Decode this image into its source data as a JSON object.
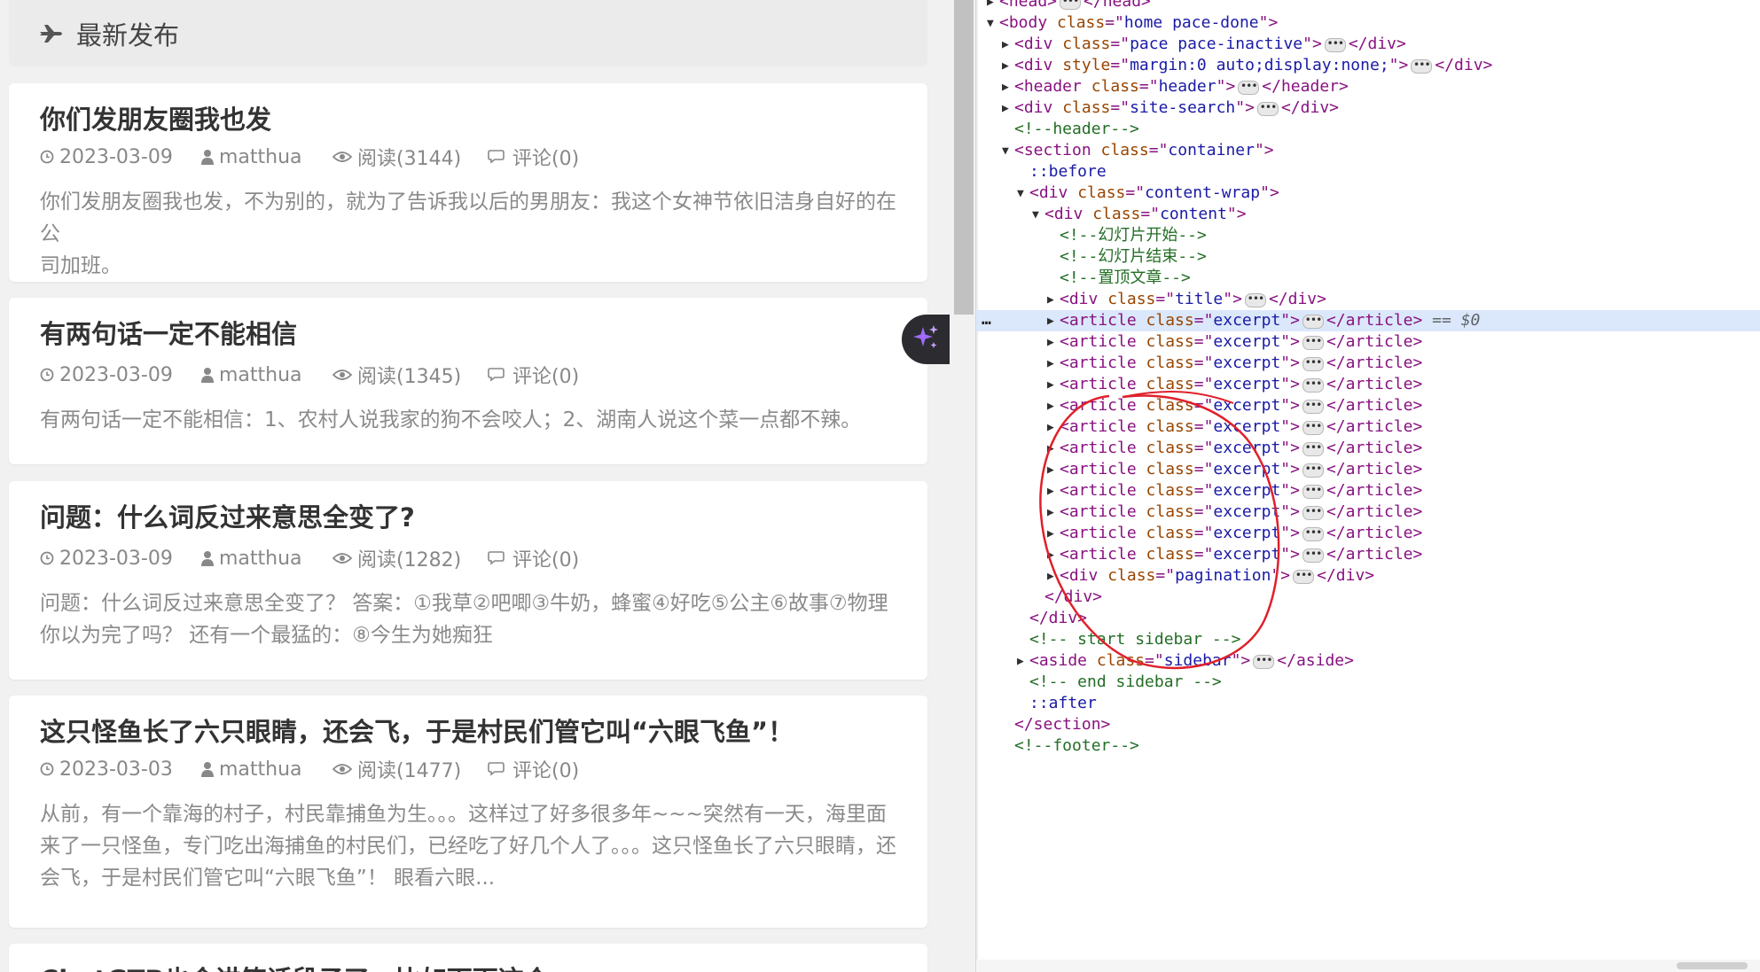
{
  "page": {
    "section_title": "最新发布",
    "posts": [
      {
        "title": "你们发朋友圈我也发",
        "date": "2023-03-09",
        "author": "matthua",
        "views": "阅读(3144)",
        "comments": "评论(0)",
        "excerpt": [
          "你们发朋友圈我也发，不为别的，就为了告诉我以后的男朋友：我这个女神节依旧洁身自好的在公",
          "司加班。"
        ]
      },
      {
        "title": "有两句话一定不能相信",
        "date": "2023-03-09",
        "author": "matthua",
        "views": "阅读(1345)",
        "comments": "评论(0)",
        "excerpt": [
          "有两句话一定不能相信：1、农村人说我家的狗不会咬人；2、湖南人说这个菜一点都不辣。"
        ]
      },
      {
        "title": "问题：什么词反过来意思全变了?",
        "date": "2023-03-09",
        "author": "matthua",
        "views": "阅读(1282)",
        "comments": "评论(0)",
        "excerpt": [
          "问题：什么词反过来意思全变了？ 答案：①我草②吧唧③牛奶，蜂蜜④好吃⑤公主⑥故事⑦物理",
          "你以为完了吗？ 还有一个最猛的：⑧今生为她痴狂"
        ]
      },
      {
        "title": "这只怪鱼长了六只眼睛，还会飞，于是村民们管它叫“六眼飞鱼”！",
        "date": "2023-03-03",
        "author": "matthua",
        "views": "阅读(1477)",
        "comments": "评论(0)",
        "excerpt": [
          "从前，有一个靠海的村子，村民靠捕鱼为生。。。这样过了好多很多年~~~突然有一天，海里面",
          "来了一只怪鱼，专门吃出海捕鱼的村民们，已经吃了好几个人了。。。这只怪鱼长了六只眼睛，还",
          "会飞，于是村民们管它叫“六眼飞鱼”！ 眼看六眼..."
        ]
      },
      {
        "title": "ChatGTP也会讲笑话段子了，比如下面这个",
        "date": "",
        "author": "",
        "views": "",
        "comments": "",
        "excerpt": []
      }
    ]
  },
  "devtools": {
    "selected_suffix": "== $0",
    "lines": [
      {
        "indent": 1,
        "toggle": "right",
        "parts": [
          [
            "tag",
            "<head>"
          ],
          [
            "ell",
            ""
          ],
          [
            "tag",
            "</head>"
          ]
        ]
      },
      {
        "indent": 1,
        "toggle": "down",
        "parts": [
          [
            "tag",
            "<body "
          ],
          [
            "attr",
            "class"
          ],
          [
            "tag",
            "=\""
          ],
          [
            "val",
            "home  pace-done"
          ],
          [
            "tag",
            "\">"
          ]
        ]
      },
      {
        "indent": 2,
        "toggle": "right",
        "parts": [
          [
            "tag",
            "<div "
          ],
          [
            "attr",
            "class"
          ],
          [
            "tag",
            "=\""
          ],
          [
            "val",
            "pace  pace-inactive"
          ],
          [
            "tag",
            "\">"
          ],
          [
            "ell",
            ""
          ],
          [
            "tag",
            "</div>"
          ]
        ]
      },
      {
        "indent": 2,
        "toggle": "right",
        "parts": [
          [
            "tag",
            "<div "
          ],
          [
            "attr",
            "style"
          ],
          [
            "tag",
            "=\""
          ],
          [
            "val",
            "margin:0 auto;display:none;"
          ],
          [
            "tag",
            "\">"
          ],
          [
            "ell",
            ""
          ],
          [
            "tag",
            "</div>"
          ]
        ]
      },
      {
        "indent": 2,
        "toggle": "right",
        "parts": [
          [
            "tag",
            "<header "
          ],
          [
            "attr",
            "class"
          ],
          [
            "tag",
            "=\""
          ],
          [
            "val",
            "header"
          ],
          [
            "tag",
            "\">"
          ],
          [
            "ell",
            ""
          ],
          [
            "tag",
            "</header>"
          ]
        ]
      },
      {
        "indent": 2,
        "toggle": "right",
        "parts": [
          [
            "tag",
            "<div "
          ],
          [
            "attr",
            "class"
          ],
          [
            "tag",
            "=\""
          ],
          [
            "val",
            "site-search"
          ],
          [
            "tag",
            "\">"
          ],
          [
            "ell",
            ""
          ],
          [
            "tag",
            "</div>"
          ]
        ]
      },
      {
        "indent": 2,
        "toggle": "",
        "parts": [
          [
            "cmt",
            "<!--header-->"
          ]
        ]
      },
      {
        "indent": 2,
        "toggle": "down",
        "parts": [
          [
            "tag",
            "<section "
          ],
          [
            "attr",
            "class"
          ],
          [
            "tag",
            "=\""
          ],
          [
            "val",
            "container"
          ],
          [
            "tag",
            "\">"
          ]
        ]
      },
      {
        "indent": 3,
        "toggle": "",
        "parts": [
          [
            "pseudo",
            "::before"
          ]
        ]
      },
      {
        "indent": 3,
        "toggle": "down",
        "parts": [
          [
            "tag",
            "<div "
          ],
          [
            "attr",
            "class"
          ],
          [
            "tag",
            "=\""
          ],
          [
            "val",
            "content-wrap"
          ],
          [
            "tag",
            "\">"
          ]
        ]
      },
      {
        "indent": 4,
        "toggle": "down",
        "parts": [
          [
            "tag",
            "<div "
          ],
          [
            "attr",
            "class"
          ],
          [
            "tag",
            "=\""
          ],
          [
            "val",
            "content"
          ],
          [
            "tag",
            "\">"
          ]
        ]
      },
      {
        "indent": 5,
        "toggle": "",
        "parts": [
          [
            "cmt",
            "<!--幻灯片开始-->"
          ]
        ]
      },
      {
        "indent": 5,
        "toggle": "",
        "parts": [
          [
            "cmt",
            "<!--幻灯片结束-->"
          ]
        ]
      },
      {
        "indent": 5,
        "toggle": "",
        "parts": [
          [
            "cmt",
            "<!--置顶文章-->"
          ]
        ]
      },
      {
        "indent": 5,
        "toggle": "right",
        "parts": [
          [
            "tag",
            "<div "
          ],
          [
            "attr",
            "class"
          ],
          [
            "tag",
            "=\""
          ],
          [
            "val",
            "title"
          ],
          [
            "tag",
            "\">"
          ],
          [
            "ell",
            ""
          ],
          [
            "tag",
            "</div>"
          ]
        ]
      },
      {
        "indent": 5,
        "toggle": "right",
        "selected": true,
        "parts": [
          [
            "tag",
            "<article "
          ],
          [
            "attr",
            "class"
          ],
          [
            "tag",
            "=\""
          ],
          [
            "val",
            "excerpt"
          ],
          [
            "tag",
            "\">"
          ],
          [
            "ell",
            ""
          ],
          [
            "tag",
            "</article>"
          ]
        ]
      },
      {
        "indent": 5,
        "toggle": "right",
        "parts": [
          [
            "tag",
            "<article "
          ],
          [
            "attr",
            "class"
          ],
          [
            "tag",
            "=\""
          ],
          [
            "val",
            "excerpt"
          ],
          [
            "tag",
            "\">"
          ],
          [
            "ell",
            ""
          ],
          [
            "tag",
            "</article>"
          ]
        ]
      },
      {
        "indent": 5,
        "toggle": "right",
        "parts": [
          [
            "tag",
            "<article "
          ],
          [
            "attr",
            "class"
          ],
          [
            "tag",
            "=\""
          ],
          [
            "val",
            "excerpt"
          ],
          [
            "tag",
            "\">"
          ],
          [
            "ell",
            ""
          ],
          [
            "tag",
            "</article>"
          ]
        ]
      },
      {
        "indent": 5,
        "toggle": "right",
        "parts": [
          [
            "tag",
            "<article "
          ],
          [
            "attr",
            "class"
          ],
          [
            "tag",
            "=\""
          ],
          [
            "val",
            "excerpt"
          ],
          [
            "tag",
            "\">"
          ],
          [
            "ell",
            ""
          ],
          [
            "tag",
            "</article>"
          ]
        ]
      },
      {
        "indent": 5,
        "toggle": "right",
        "parts": [
          [
            "tag",
            "<article "
          ],
          [
            "attr",
            "class"
          ],
          [
            "tag",
            "=\""
          ],
          [
            "val",
            "excerpt"
          ],
          [
            "tag",
            "\">"
          ],
          [
            "ell",
            ""
          ],
          [
            "tag",
            "</article>"
          ]
        ]
      },
      {
        "indent": 5,
        "toggle": "right",
        "parts": [
          [
            "tag",
            "<article "
          ],
          [
            "attr",
            "class"
          ],
          [
            "tag",
            "=\""
          ],
          [
            "val",
            "excerpt"
          ],
          [
            "tag",
            "\">"
          ],
          [
            "ell",
            ""
          ],
          [
            "tag",
            "</article>"
          ]
        ]
      },
      {
        "indent": 5,
        "toggle": "right",
        "parts": [
          [
            "tag",
            "<article "
          ],
          [
            "attr",
            "class"
          ],
          [
            "tag",
            "=\""
          ],
          [
            "val",
            "excerpt"
          ],
          [
            "tag",
            "\">"
          ],
          [
            "ell",
            ""
          ],
          [
            "tag",
            "</article>"
          ]
        ]
      },
      {
        "indent": 5,
        "toggle": "right",
        "parts": [
          [
            "tag",
            "<article "
          ],
          [
            "attr",
            "class"
          ],
          [
            "tag",
            "=\""
          ],
          [
            "val",
            "excerpt"
          ],
          [
            "tag",
            "\">"
          ],
          [
            "ell",
            ""
          ],
          [
            "tag",
            "</article>"
          ]
        ]
      },
      {
        "indent": 5,
        "toggle": "right",
        "parts": [
          [
            "tag",
            "<article "
          ],
          [
            "attr",
            "class"
          ],
          [
            "tag",
            "=\""
          ],
          [
            "val",
            "excerpt"
          ],
          [
            "tag",
            "\">"
          ],
          [
            "ell",
            ""
          ],
          [
            "tag",
            "</article>"
          ]
        ]
      },
      {
        "indent": 5,
        "toggle": "right",
        "parts": [
          [
            "tag",
            "<article "
          ],
          [
            "attr",
            "class"
          ],
          [
            "tag",
            "=\""
          ],
          [
            "val",
            "excerpt"
          ],
          [
            "tag",
            "\">"
          ],
          [
            "ell",
            ""
          ],
          [
            "tag",
            "</article>"
          ]
        ]
      },
      {
        "indent": 5,
        "toggle": "right",
        "parts": [
          [
            "tag",
            "<article "
          ],
          [
            "attr",
            "class"
          ],
          [
            "tag",
            "=\""
          ],
          [
            "val",
            "excerpt"
          ],
          [
            "tag",
            "\">"
          ],
          [
            "ell",
            ""
          ],
          [
            "tag",
            "</article>"
          ]
        ]
      },
      {
        "indent": 5,
        "toggle": "right",
        "parts": [
          [
            "tag",
            "<article "
          ],
          [
            "attr",
            "class"
          ],
          [
            "tag",
            "=\""
          ],
          [
            "val",
            "excerpt"
          ],
          [
            "tag",
            "\">"
          ],
          [
            "ell",
            ""
          ],
          [
            "tag",
            "</article>"
          ]
        ]
      },
      {
        "indent": 5,
        "toggle": "right",
        "parts": [
          [
            "tag",
            "<div "
          ],
          [
            "attr",
            "class"
          ],
          [
            "tag",
            "=\""
          ],
          [
            "val",
            "pagination"
          ],
          [
            "tag",
            "\">"
          ],
          [
            "ell",
            ""
          ],
          [
            "tag",
            "</div>"
          ]
        ]
      },
      {
        "indent": 4,
        "toggle": "",
        "parts": [
          [
            "tag",
            "</div>"
          ]
        ]
      },
      {
        "indent": 3,
        "toggle": "",
        "parts": [
          [
            "tag",
            "</div>"
          ]
        ]
      },
      {
        "indent": 3,
        "toggle": "",
        "parts": [
          [
            "cmt",
            "<!-- start sidebar -->"
          ]
        ]
      },
      {
        "indent": 3,
        "toggle": "right",
        "parts": [
          [
            "tag",
            "<aside "
          ],
          [
            "attr",
            "class"
          ],
          [
            "tag",
            "=\""
          ],
          [
            "val",
            "sidebar"
          ],
          [
            "tag",
            "\">"
          ],
          [
            "ell",
            ""
          ],
          [
            "tag",
            "</aside>"
          ]
        ]
      },
      {
        "indent": 3,
        "toggle": "",
        "parts": [
          [
            "cmt",
            "<!-- end sidebar -->"
          ]
        ]
      },
      {
        "indent": 3,
        "toggle": "",
        "parts": [
          [
            "pseudo",
            "::after"
          ]
        ]
      },
      {
        "indent": 2,
        "toggle": "",
        "parts": [
          [
            "tag",
            "</section>"
          ]
        ]
      },
      {
        "indent": 2,
        "toggle": "",
        "parts": [
          [
            "cmt",
            "<!--footer-->"
          ]
        ]
      }
    ]
  },
  "colors": {
    "annotation": "#e0202a",
    "sparkle": "#a06bff",
    "selected_row": "#dbe8fb"
  }
}
